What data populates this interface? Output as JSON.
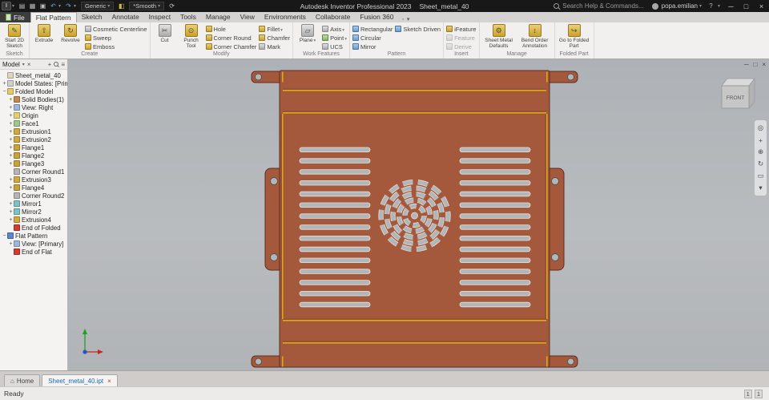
{
  "titlebar": {
    "app_title": "Autodesk Inventor Professional 2023",
    "doc_title": "Sheet_metal_40",
    "material_dropdown": "Generic",
    "appearance_dropdown": "*Smooth",
    "search_placeholder": "Search Help & Commands...",
    "user": "popa.emilian"
  },
  "tab_row": {
    "file": "File",
    "tabs": [
      "Flat Pattern",
      "Sketch",
      "Annotate",
      "Inspect",
      "Tools",
      "Manage",
      "View",
      "Environments",
      "Collaborate",
      "Fusion 360"
    ],
    "active": "Flat Pattern"
  },
  "ribbon": {
    "sketch": {
      "label": "Sketch",
      "start2d": "Start 2D Sketch"
    },
    "create": {
      "label": "Create",
      "extrude": "Extrude",
      "revolve": "Revolve",
      "cosmetic": "Cosmetic Centerline",
      "sweep": "Sweep",
      "emboss": "Emboss"
    },
    "modify": {
      "label": "Modify",
      "cut": "Cut",
      "punch": "Punch Tool",
      "hole": "Hole",
      "corner_round": "Corner Round",
      "corner_chamfer": "Corner Chamfer",
      "fillet": "Fillet",
      "chamfer": "Chamfer",
      "mark": "Mark"
    },
    "work": {
      "label": "Work Features",
      "plane": "Plane",
      "axis": "Axis",
      "point": "Point",
      "ucs": "UCS"
    },
    "pattern": {
      "label": "Pattern",
      "rectangular": "Rectangular",
      "circular": "Circular",
      "mirror": "Mirror",
      "sketch_driven": "Sketch Driven"
    },
    "insert": {
      "label": "Insert",
      "ifeature": "iFeature",
      "feature": "Feature",
      "derive": "Derive"
    },
    "manage": {
      "label": "Manage",
      "defaults": "Sheet Metal Defaults",
      "bend_order": "Bend Order Annotation"
    },
    "folded": {
      "label": "Folded Part",
      "goto": "Go to Folded Part"
    }
  },
  "browser": {
    "header": "Model",
    "items": [
      {
        "label": "Sheet_metal_40",
        "indent": 0,
        "exp": "",
        "icon": "part"
      },
      {
        "label": "Model States: [Primary]",
        "indent": 0,
        "exp": "+",
        "icon": "states"
      },
      {
        "label": "Folded Model",
        "indent": 0,
        "exp": "-",
        "icon": "folder"
      },
      {
        "label": "Solid Bodies(1)",
        "indent": 1,
        "exp": "+",
        "icon": "solids"
      },
      {
        "label": "View: Right",
        "indent": 1,
        "exp": "+",
        "icon": "view"
      },
      {
        "label": "Origin",
        "indent": 1,
        "exp": "+",
        "icon": "origin"
      },
      {
        "label": "Face1",
        "indent": 1,
        "exp": "+",
        "icon": "face"
      },
      {
        "label": "Extrusion1",
        "indent": 1,
        "exp": "+",
        "icon": "extrusion"
      },
      {
        "label": "Extrusion2",
        "indent": 1,
        "exp": "+",
        "icon": "extrusion"
      },
      {
        "label": "Flange1",
        "indent": 1,
        "exp": "+",
        "icon": "flange"
      },
      {
        "label": "Flange2",
        "indent": 1,
        "exp": "+",
        "icon": "flange"
      },
      {
        "label": "Flange3",
        "indent": 1,
        "exp": "+",
        "icon": "flange"
      },
      {
        "label": "Corner Round1",
        "indent": 1,
        "exp": "",
        "icon": "corner"
      },
      {
        "label": "Extrusion3",
        "indent": 1,
        "exp": "+",
        "icon": "extrusion"
      },
      {
        "label": "Flange4",
        "indent": 1,
        "exp": "+",
        "icon": "flange"
      },
      {
        "label": "Corner Round2",
        "indent": 1,
        "exp": "",
        "icon": "corner"
      },
      {
        "label": "Mirror1",
        "indent": 1,
        "exp": "+",
        "icon": "mirror"
      },
      {
        "label": "Mirror2",
        "indent": 1,
        "exp": "+",
        "icon": "mirror"
      },
      {
        "label": "Extrusion4",
        "indent": 1,
        "exp": "+",
        "icon": "extrusion"
      },
      {
        "label": "End of Folded",
        "indent": 1,
        "exp": "",
        "icon": "eof"
      },
      {
        "label": "Flat Pattern",
        "indent": 0,
        "exp": "-",
        "icon": "flat"
      },
      {
        "label": "View: [Primary]",
        "indent": 1,
        "exp": "+",
        "icon": "view"
      },
      {
        "label": "End of Flat",
        "indent": 1,
        "exp": "",
        "icon": "eof"
      }
    ]
  },
  "viewport": {
    "viewcube_label": "FRONT"
  },
  "part": {
    "fill": "#a5593c",
    "edge": "#5f2d1b",
    "cut_fill": "#b3b6b9",
    "cut_stroke": "#e9e4da",
    "bend_color": "#e8b80a",
    "slot_columns": 2,
    "slots_per_column": 15
  },
  "doc_tabs": {
    "home": "Home",
    "active": "Sheet_metal_40.ipt"
  },
  "status": {
    "left": "Ready",
    "count_a": "1",
    "count_b": "1"
  }
}
